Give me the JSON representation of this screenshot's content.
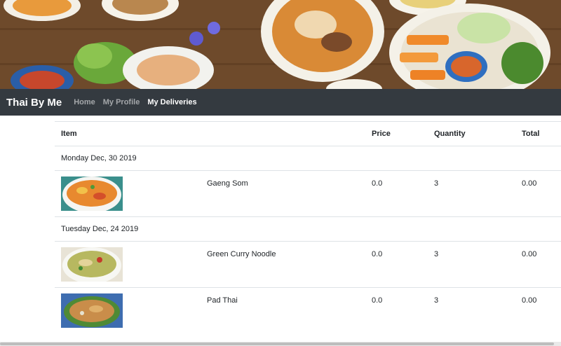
{
  "navbar": {
    "brand": "Thai By Me",
    "links": [
      {
        "label": "Home",
        "active": false
      },
      {
        "label": "My Profile",
        "active": false
      },
      {
        "label": "My Deliveries",
        "active": true
      }
    ]
  },
  "table": {
    "headers": {
      "item": "Item",
      "price": "Price",
      "quantity": "Quantity",
      "total": "Total"
    },
    "groups": [
      {
        "date": "Monday Dec, 30 2019",
        "items": [
          {
            "name": "Gaeng Som",
            "price": "0.0",
            "quantity": "3",
            "total": "0.00"
          }
        ]
      },
      {
        "date": "Tuesday Dec, 24 2019",
        "items": [
          {
            "name": "Green Curry Noodle",
            "price": "0.0",
            "quantity": "3",
            "total": "0.00"
          },
          {
            "name": "Pad Thai",
            "price": "0.0",
            "quantity": "3",
            "total": "0.00"
          }
        ]
      }
    ]
  },
  "colors": {
    "navbar_bg": "#343a40",
    "border": "#dee2e6",
    "text": "#212529"
  }
}
